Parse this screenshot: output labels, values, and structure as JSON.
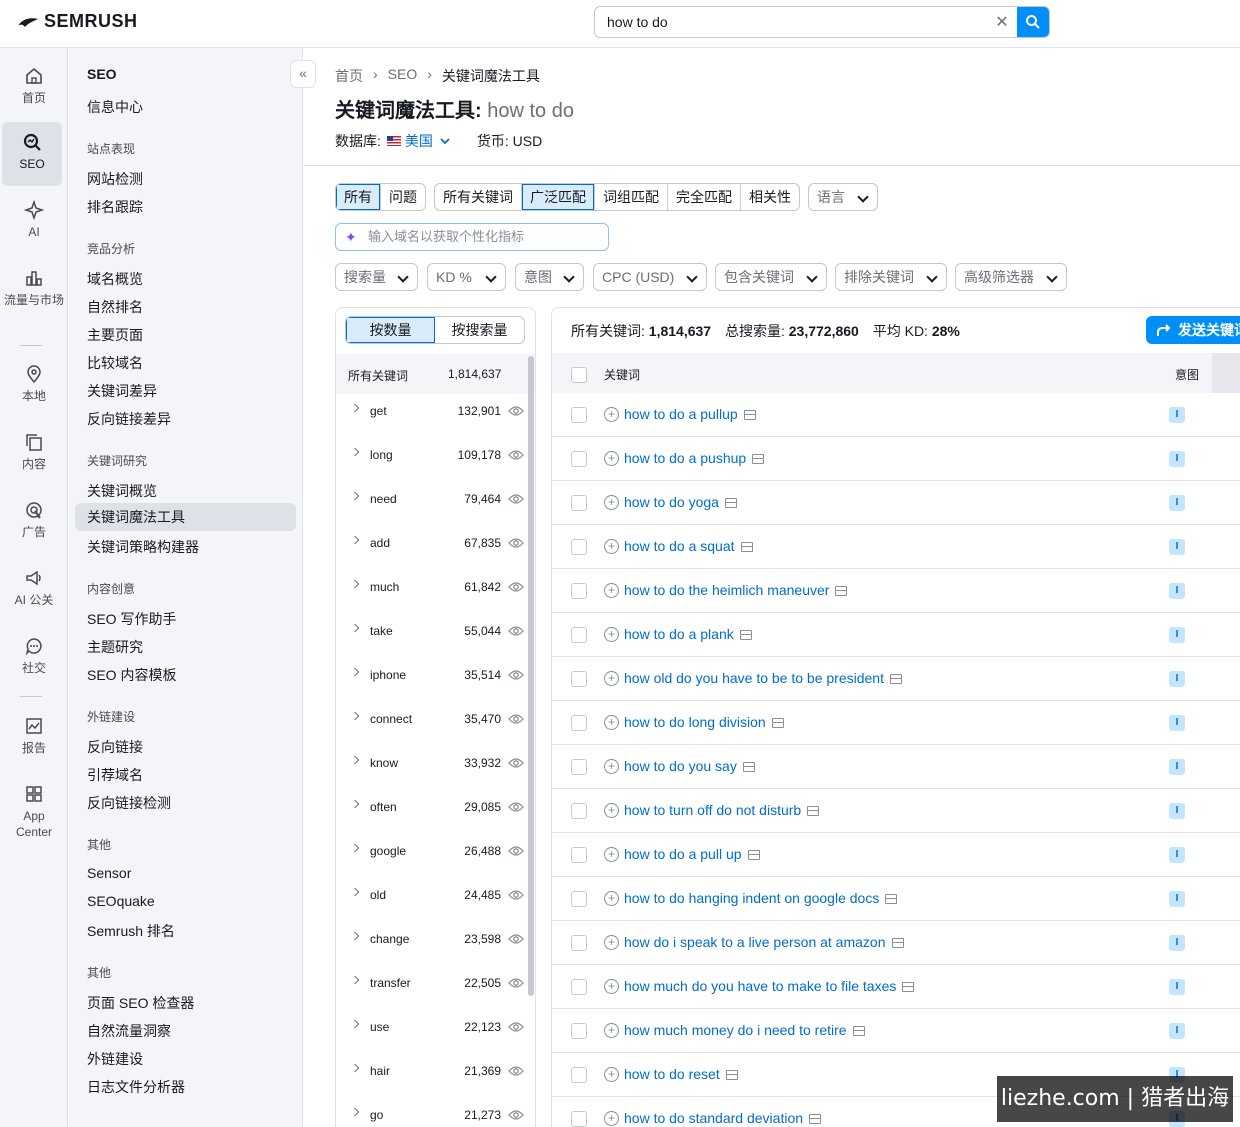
{
  "brand": {
    "logo_text": "SEMRUSH",
    "accent": "#008ff8"
  },
  "search": {
    "value": "how to do",
    "clear_icon": "close-icon",
    "search_icon": "search-icon"
  },
  "rail": [
    {
      "label": "首页",
      "icon": "home-icon"
    },
    {
      "label": "SEO",
      "icon": "seo-icon",
      "active": true
    },
    {
      "label": "AI",
      "icon": "ai-icon"
    },
    {
      "label": "流量与市场",
      "icon": "chart-icon"
    },
    {
      "label": "本地",
      "icon": "pin-icon"
    },
    {
      "label": "内容",
      "icon": "content-icon"
    },
    {
      "label": "广告",
      "icon": "ads-icon"
    },
    {
      "label": "AI 公关",
      "icon": "megaphone-icon"
    },
    {
      "label": "社交",
      "icon": "chat-icon"
    },
    {
      "label": "报告",
      "icon": "report-icon"
    },
    {
      "label": "App Center",
      "icon": "grid-icon"
    }
  ],
  "sidebar": {
    "title": "SEO",
    "top_link": "信息中心",
    "sections": [
      {
        "heading": "站点表现",
        "links": [
          "网站检测",
          "排名跟踪"
        ]
      },
      {
        "heading": "竞品分析",
        "links": [
          "域名概览",
          "自然排名",
          "主要页面",
          "比较域名",
          "关键词差异",
          "反向链接差异"
        ]
      },
      {
        "heading": "关键词研究",
        "links": [
          "关键词概览",
          "关键词魔法工具",
          "关键词策略构建器"
        ]
      },
      {
        "heading": "内容创意",
        "links": [
          "SEO 写作助手",
          "主题研究",
          "SEO 内容模板"
        ]
      },
      {
        "heading": "外链建设",
        "links": [
          "反向链接",
          "引荐域名",
          "反向链接检测"
        ]
      },
      {
        "heading": "其他",
        "links": [
          "Sensor",
          "SEOquake",
          "Semrush 排名"
        ]
      },
      {
        "heading": "其他",
        "links": [
          "页面 SEO 检查器",
          "自然流量洞察",
          "外链建设",
          "日志文件分析器"
        ]
      }
    ],
    "active_link": "关键词魔法工具",
    "collapse_label": "«"
  },
  "breadcrumb": [
    "首页",
    "SEO",
    "关键词魔法工具"
  ],
  "title": {
    "tool": "关键词魔法工具:",
    "query": "how to do"
  },
  "database": {
    "label": "数据库:",
    "country": "美国",
    "currency_label": "货币: USD"
  },
  "tabs_group1": [
    "所有",
    "问题"
  ],
  "tabs_group2": [
    "所有关键词",
    "广泛匹配",
    "词组匹配",
    "完全匹配",
    "相关性"
  ],
  "language_label": "语言",
  "domain_placeholder": "输入域名以获取个性化指标",
  "filters": [
    "搜索量",
    "KD %",
    "意图",
    "CPC (USD)",
    "包含关键词",
    "排除关键词",
    "高级筛选器"
  ],
  "groups": {
    "toggle": [
      "按数量",
      "按搜索量"
    ],
    "header_label": "所有关键词",
    "header_count": "1,814,637",
    "rows": [
      {
        "name": "get",
        "count": "132,901"
      },
      {
        "name": "long",
        "count": "109,178"
      },
      {
        "name": "need",
        "count": "79,464"
      },
      {
        "name": "add",
        "count": "67,835"
      },
      {
        "name": "much",
        "count": "61,842"
      },
      {
        "name": "take",
        "count": "55,044"
      },
      {
        "name": "iphone",
        "count": "35,514"
      },
      {
        "name": "connect",
        "count": "35,470"
      },
      {
        "name": "know",
        "count": "33,932"
      },
      {
        "name": "often",
        "count": "29,085"
      },
      {
        "name": "google",
        "count": "26,488"
      },
      {
        "name": "old",
        "count": "24,485"
      },
      {
        "name": "change",
        "count": "23,598"
      },
      {
        "name": "transfer",
        "count": "22,505"
      },
      {
        "name": "use",
        "count": "22,123"
      },
      {
        "name": "hair",
        "count": "21,369"
      },
      {
        "name": "go",
        "count": "21,273"
      }
    ]
  },
  "stats": {
    "all_kw_label": "所有关键词:",
    "all_kw_value": "1,814,637",
    "volume_label": "总搜索量:",
    "volume_value": "23,772,860",
    "kd_label": "平均 KD:",
    "kd_value": "28%"
  },
  "send_button": "发送关键词",
  "table": {
    "col_keyword": "关键词",
    "col_intent": "意图",
    "rows": [
      {
        "kw": "how to do a pullup",
        "intent": "I"
      },
      {
        "kw": "how to do a pushup",
        "intent": "I"
      },
      {
        "kw": "how to do yoga",
        "intent": "I"
      },
      {
        "kw": "how to do a squat",
        "intent": "I"
      },
      {
        "kw": "how to do the heimlich maneuver",
        "intent": "I"
      },
      {
        "kw": "how to do a plank",
        "intent": "I"
      },
      {
        "kw": "how old do you have to be to be president",
        "intent": "I"
      },
      {
        "kw": "how to do long division",
        "intent": "I"
      },
      {
        "kw": "how to do you say",
        "intent": "I"
      },
      {
        "kw": "how to turn off do not disturb",
        "intent": "I"
      },
      {
        "kw": "how to do a pull up",
        "intent": "I"
      },
      {
        "kw": "how to do hanging indent on google docs",
        "intent": "I"
      },
      {
        "kw": "how do i speak to a live person at amazon",
        "intent": "I"
      },
      {
        "kw": "how much do you have to make to file taxes",
        "intent": "I"
      },
      {
        "kw": "how much money do i need to retire",
        "intent": "I"
      },
      {
        "kw": "how to do reset",
        "intent": "I"
      },
      {
        "kw": "how to do standard deviation",
        "intent": "I"
      }
    ]
  },
  "watermark": "liezhe.com | 猎者出海"
}
